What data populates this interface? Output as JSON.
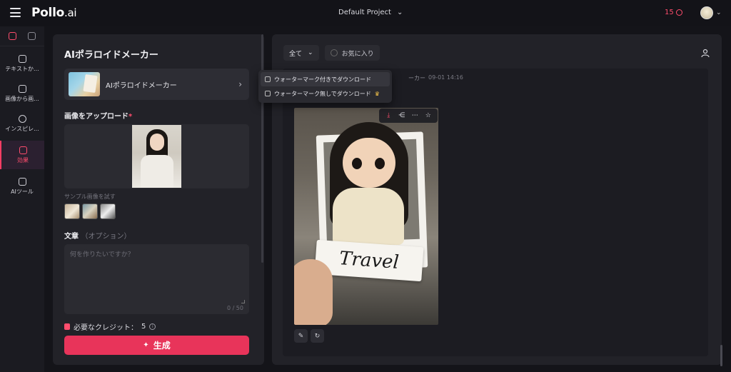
{
  "app": {
    "logo": "Pollo",
    "logo_suffix": ".ai",
    "project": "Default Project",
    "credits": "15"
  },
  "rail": {
    "items": [
      {
        "label": "テキストか..."
      },
      {
        "label": "画像から画..."
      },
      {
        "label": "インスピレ..."
      },
      {
        "label": "効果"
      },
      {
        "label": "AIツール"
      }
    ]
  },
  "left": {
    "title": "AIポラロイドメーカー",
    "tool_name": "AIポラロイドメーカー",
    "upload_label": "画像をアップロード",
    "required_mark": "*",
    "sample_label": "サンプル画像を試す",
    "prompt_label": "文章",
    "prompt_optional": "（オプション）",
    "prompt_placeholder": "何を作りたいですか？",
    "char_count": "0 / 50",
    "credits_needed": "必要なクレジット：",
    "credits_value": "5",
    "generate": "生成"
  },
  "right": {
    "filter": "全て",
    "favorite": "お気に入り",
    "meta_label": "ーカー",
    "meta_time": "09-01 14:16",
    "card_text": "Travel"
  },
  "dropdown": {
    "items": [
      {
        "label": "ウォーターマーク付きでダウンロード"
      },
      {
        "label": "ウォーターマーク無しでダウンロード"
      }
    ]
  },
  "colors": {
    "accent": "#e8345a",
    "credit": "#ff4d6d",
    "panel": "#222228"
  },
  "icons": [
    "menu-icon",
    "chevron-down-icon",
    "coin-icon",
    "download-icon",
    "share-icon",
    "more-icon",
    "star-icon",
    "edit-icon",
    "refresh-icon",
    "user-icon",
    "sparkle-icon",
    "info-icon",
    "crown-icon"
  ]
}
